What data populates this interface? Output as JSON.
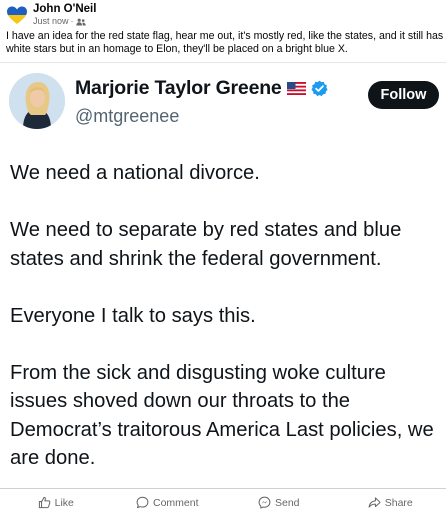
{
  "post": {
    "author": "John O'Neil",
    "time": "Just now",
    "separator": "·",
    "audience_icon": "friends-icon",
    "text": "I have an idea for the red state flag, hear me out, it's mostly red, like the states, and it still has white stars but in an homage to Elon, they'll be placed on a bright blue X."
  },
  "embed": {
    "name": "Marjorie Taylor Greene",
    "flag": "🇺🇸",
    "handle": "@mtgreenee",
    "follow_label": "Follow",
    "paragraphs": [
      "We need a national divorce.",
      "We need to separate by red states and blue states and shrink the federal government.",
      "Everyone I talk to says this.",
      "From the sick and disgusting woke culture issues shoved down our throats to the Democrat’s traitorous America Last policies, we are done."
    ]
  },
  "actions": {
    "like": "Like",
    "comment": "Comment",
    "send": "Send",
    "share": "Share"
  },
  "colors": {
    "follow_bg": "#0f1419",
    "verified": "#1d9bf0",
    "heart_blue": "#1f5fbf",
    "heart_yellow": "#f5c518",
    "secondary_text": "#65676b"
  }
}
